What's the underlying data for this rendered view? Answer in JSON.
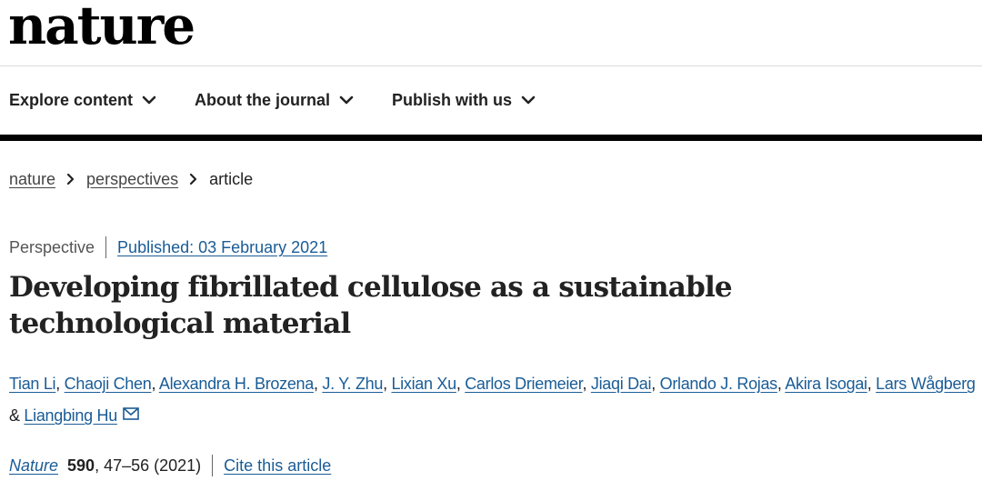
{
  "brand": {
    "logo": "nature"
  },
  "nav": [
    {
      "label": "Explore content"
    },
    {
      "label": "About the journal"
    },
    {
      "label": "Publish with us"
    }
  ],
  "breadcrumb": [
    "nature",
    "perspectives",
    "article"
  ],
  "article": {
    "type": "Perspective",
    "published": "Published: 03 February 2021",
    "title": "Developing fibrillated cellulose as a sustainable technological material",
    "authors": [
      "Tian Li",
      "Chaoji Chen",
      "Alexandra H. Brozena",
      "J. Y. Zhu",
      "Lixian Xu",
      "Carlos Driemeier",
      "Jiaqi Dai",
      "Orlando J. Rojas",
      "Akira Isogai",
      "Lars Wågberg",
      "Liangbing Hu"
    ],
    "journal": "Nature",
    "volume": "590",
    "pages_year": ", 47–56 (2021)",
    "cite_label": "Cite this article"
  }
}
